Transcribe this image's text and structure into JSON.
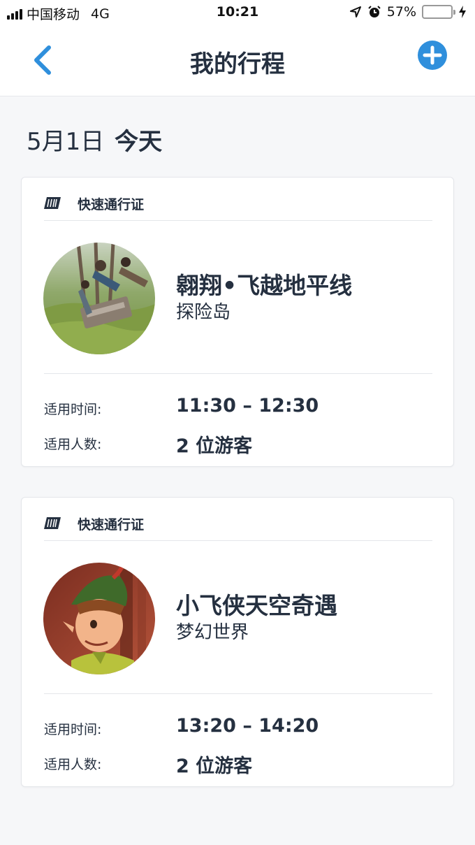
{
  "status_bar": {
    "carrier": "中国移动",
    "network": "4G",
    "time": "10:21",
    "battery_percent": "57%",
    "battery_level": 0.57
  },
  "nav": {
    "title": "我的行程",
    "back_icon": "chevron-left-icon",
    "add_icon": "plus-circle-icon",
    "accent_color": "#2f8fdc"
  },
  "date_heading": {
    "date": "5月1日",
    "today": "今天"
  },
  "passes": [
    {
      "type": "快速通行证",
      "attraction": "翱翔•飞越地平线",
      "area": "探险岛",
      "time_label": "适用时间:",
      "time_value": "11:30 – 12:30",
      "guests_label": "适用人数:",
      "guests_value": "2 位游客"
    },
    {
      "type": "快速通行证",
      "attraction": "小飞侠天空奇遇",
      "area": "梦幻世界",
      "time_label": "适用时间:",
      "time_value": "13:20 – 14:20",
      "guests_label": "适用人数:",
      "guests_value": "2 位游客"
    }
  ]
}
